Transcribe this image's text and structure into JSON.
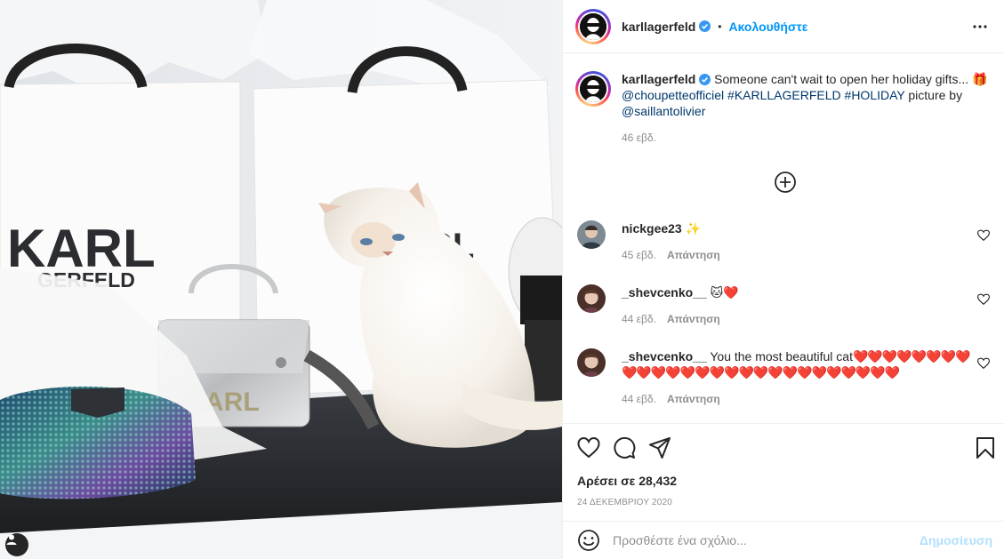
{
  "post": {
    "image_alt": "White fluffy cat among KARL LAGERFELD shopping bags",
    "bag_left_text": [
      "KARL",
      "GERFELD"
    ],
    "bag_right_text": "RL",
    "silver_bag_text": "ARL"
  },
  "header": {
    "username": "karllagerfeld",
    "separator": "•",
    "follow_label": "Ακολουθήστε",
    "more_icon": "more-horizontal-icon"
  },
  "caption": {
    "username": "karllagerfeld",
    "text_start": "Someone can't wait to open her holiday gifts... ",
    "gift_emoji": "🎁",
    "mention1": "@choupetteofficiel",
    "hashtag1": "#KARLLAGERFELD",
    "hashtag2": "#HOLIDAY",
    "text_mid": " picture by ",
    "mention2": "@saillantolivier",
    "time": "46 εβδ."
  },
  "comments": [
    {
      "username": "nickgee23",
      "text": " ✨",
      "time": "45 εβδ.",
      "reply": "Απάντηση"
    },
    {
      "username": "_shevcenko__",
      "text": " 🐱❤️",
      "time": "44 εβδ.",
      "reply": "Απάντηση"
    },
    {
      "username": "_shevcenko__",
      "text": " You the most beautiful cat",
      "hearts": "❤️❤️❤️❤️❤️❤️❤️❤️❤️❤️❤️❤️❤️❤️❤️❤️❤️❤️❤️❤️❤️❤️❤️❤️❤️❤️❤️",
      "time": "44 εβδ.",
      "reply": "Απάντηση"
    }
  ],
  "actions": {
    "likes_label": "Αρέσει σε 28,432",
    "date": "24 ΔΕΚΕΜΒΡΙΟΥ 2020"
  },
  "comment_box": {
    "placeholder": "Προσθέστε ένα σχόλιο...",
    "post_label": "Δημοσίευση"
  },
  "colors": {
    "link": "#00376b",
    "follow": "#0095f6",
    "post_disabled": "#b2dffc",
    "muted": "#8e8e8e"
  }
}
